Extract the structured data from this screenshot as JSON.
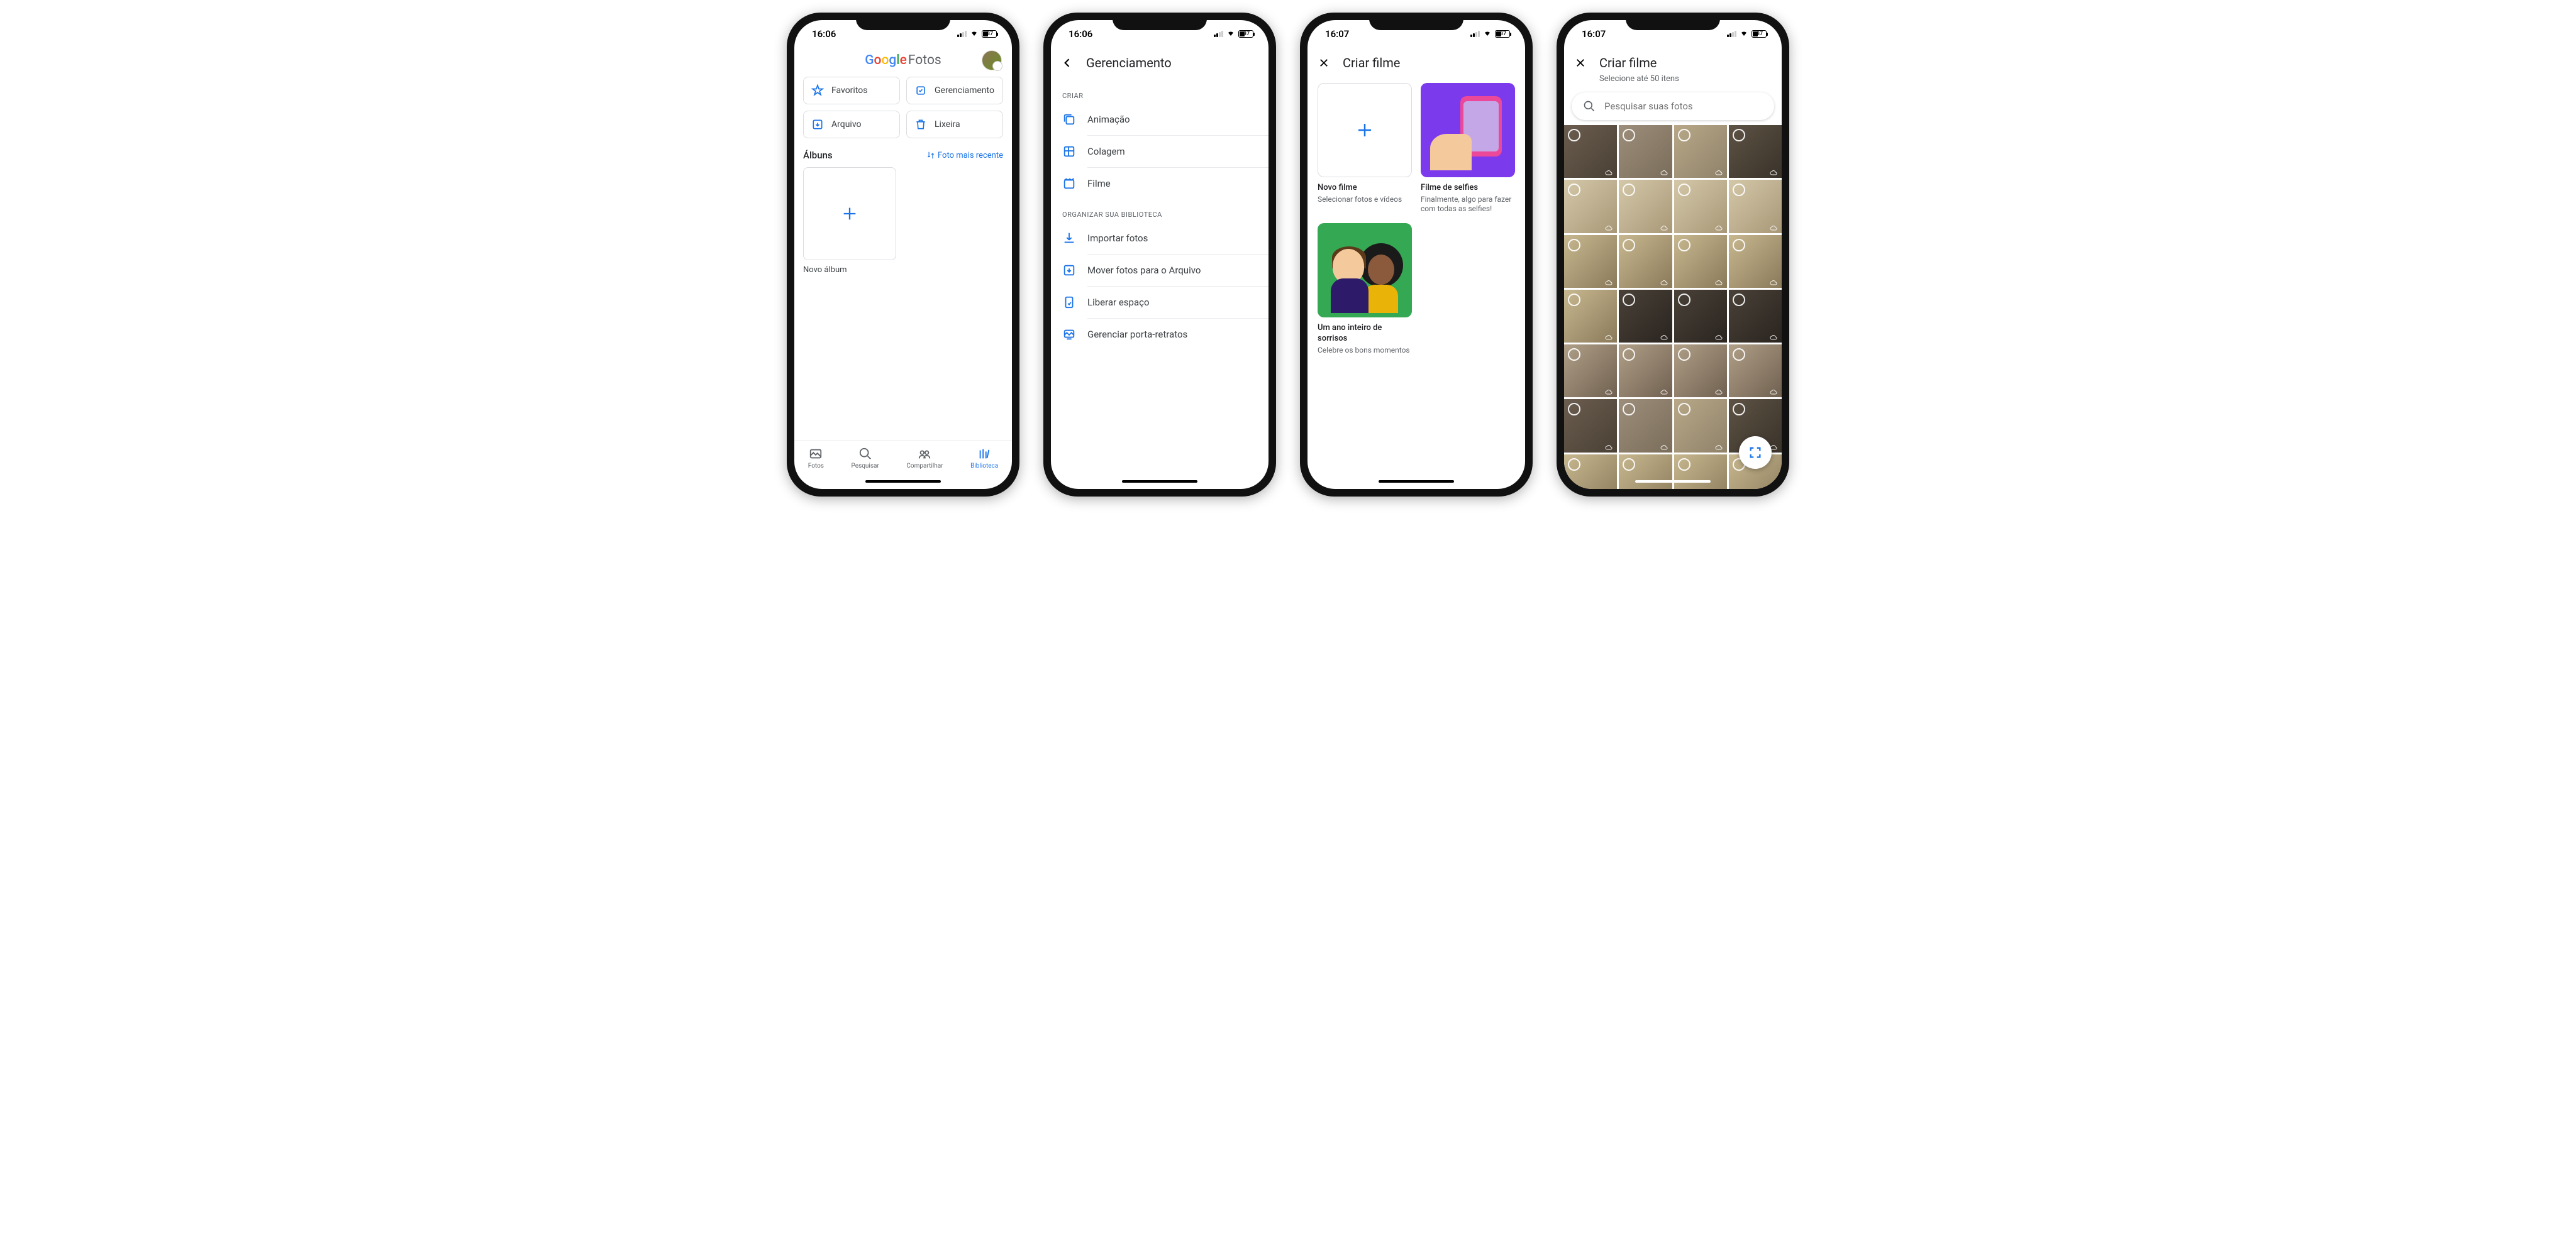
{
  "status": {
    "time1": "16:06",
    "time2": "16:07",
    "battery": "37"
  },
  "screen1": {
    "logo_google": "Google",
    "logo_fotos": "Fotos",
    "quick": {
      "favoritos": "Favoritos",
      "gerenciamento": "Gerenciamento",
      "arquivo": "Arquivo",
      "lixeira": "Lixeira"
    },
    "albums_title": "Álbuns",
    "albums_sort": "Foto mais recente",
    "new_album": "Novo álbum",
    "tabs": {
      "fotos": "Fotos",
      "pesquisar": "Pesquisar",
      "compartilhar": "Compartilhar",
      "biblioteca": "Biblioteca"
    }
  },
  "screen2": {
    "title": "Gerenciamento",
    "sec_criar": "CRIAR",
    "items_criar": {
      "animacao": "Animação",
      "colagem": "Colagem",
      "filme": "Filme"
    },
    "sec_org": "ORGANIZAR SUA BIBLIOTECA",
    "items_org": {
      "importar": "Importar fotos",
      "mover": "Mover fotos para o Arquivo",
      "liberar": "Liberar espaço",
      "porta": "Gerenciar porta-retratos"
    }
  },
  "screen3": {
    "title": "Criar filme",
    "cards": {
      "novo": {
        "title": "Novo filme",
        "sub": "Selecionar fotos e vídeos"
      },
      "selfie": {
        "title": "Filme de selfies",
        "sub": "Finalmente, algo para fazer com todas as selfies!"
      },
      "sorrisos": {
        "title": "Um ano inteiro de sorrisos",
        "sub": "Celebre os bons momentos"
      }
    }
  },
  "screen4": {
    "title": "Criar filme",
    "subtitle": "Selecione até 50 itens",
    "search_placeholder": "Pesquisar suas fotos"
  }
}
